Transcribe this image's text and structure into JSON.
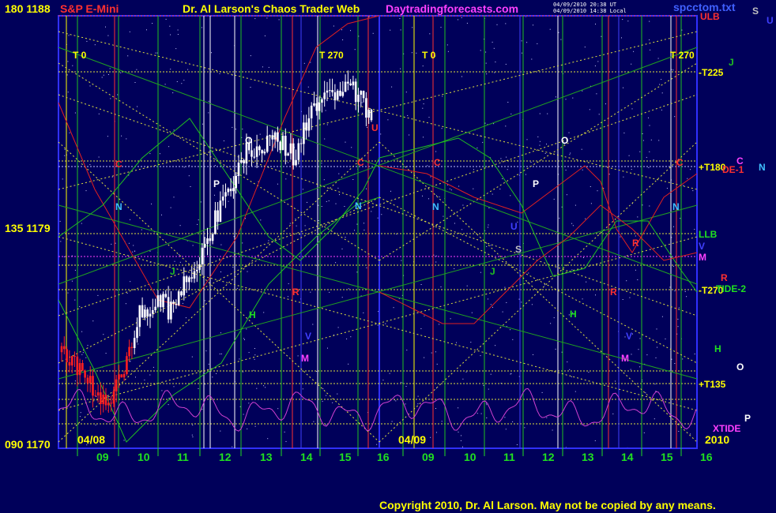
{
  "header": {
    "left_label": "180  1188",
    "symbol": "S&P E-Mini",
    "title": "Dr. Al Larson's Chaos Trader Web",
    "site": "Daytradingforecasts.com",
    "stamp1": "04/09/2010 20:38 UT",
    "stamp2": "04/09/2010 14:38 Local",
    "file": "spcctom.txt",
    "corner_s": "S",
    "corner_u": "U"
  },
  "left_labels": {
    "mid": "135  1179",
    "bottom": "090  1170"
  },
  "right_labels": [
    {
      "id": "ulb",
      "text": "ULB",
      "color": "#ff3030",
      "y": 20
    },
    {
      "id": "t225",
      "text": "-T225",
      "color": "#ffff00",
      "y": 91
    },
    {
      "id": "j",
      "text": "J",
      "color": "#20c020",
      "y": 78
    },
    {
      "id": "t180",
      "text": "+T180",
      "color": "#ffff00",
      "y": 211
    },
    {
      "id": "de1",
      "text": "DE-1",
      "color": "#ff3030",
      "y": 214
    },
    {
      "id": "c",
      "text": "C",
      "color": "#ff40ff",
      "y": 203
    },
    {
      "id": "n",
      "text": "N",
      "color": "#40c0ff",
      "y": 211
    },
    {
      "id": "llb",
      "text": "LLB",
      "color": "#20e020",
      "y": 296
    },
    {
      "id": "v",
      "text": "V",
      "color": "#4040ff",
      "y": 311
    },
    {
      "id": "m",
      "text": "M",
      "color": "#ff40ff",
      "y": 325
    },
    {
      "id": "r",
      "text": "R",
      "color": "#ff3030",
      "y": 351
    },
    {
      "id": "t270",
      "text": "-T270",
      "color": "#ffff00",
      "y": 367
    },
    {
      "id": "tide2",
      "text": "TIDE-2",
      "color": "#20e020",
      "y": 365
    },
    {
      "id": "h",
      "text": "H",
      "color": "#20e020",
      "y": 441
    },
    {
      "id": "o",
      "text": "O",
      "color": "#ffffff",
      "y": 464
    },
    {
      "id": "t135",
      "text": "+T135",
      "color": "#ffff00",
      "y": 486
    },
    {
      "id": "p",
      "text": "P",
      "color": "#ffffff",
      "y": 529
    },
    {
      "id": "xtide",
      "text": "XTIDE",
      "color": "#ff40ff",
      "y": 542
    }
  ],
  "x_axis": {
    "labels": [
      "09",
      "10",
      "11",
      "12",
      "13",
      "14",
      "15",
      "16",
      "09",
      "10",
      "11",
      "12",
      "13",
      "14",
      "15",
      "16"
    ],
    "date1": "04/08",
    "date2": "04/09",
    "year": "2010"
  },
  "markers": {
    "t0": "T  0",
    "t270": "T  270"
  },
  "point_labels": [
    {
      "t": "C",
      "c": "#ff3030"
    },
    {
      "t": "N",
      "c": "#40c0ff"
    },
    {
      "t": "P",
      "c": "#ffffff"
    },
    {
      "t": "O",
      "c": "#ffffff"
    },
    {
      "t": "J",
      "c": "#20c020"
    },
    {
      "t": "H",
      "c": "#20e020"
    },
    {
      "t": "R",
      "c": "#ff3030"
    },
    {
      "t": "V",
      "c": "#4040ff"
    },
    {
      "t": "M",
      "c": "#ff40ff"
    },
    {
      "t": "C",
      "c": "#ff3030"
    },
    {
      "t": "N",
      "c": "#40c0ff"
    },
    {
      "t": "U",
      "c": "#ff3030"
    },
    {
      "t": "C",
      "c": "#ff3030"
    },
    {
      "t": "N",
      "c": "#40c0ff"
    },
    {
      "t": "O",
      "c": "#ffffff"
    },
    {
      "t": "P",
      "c": "#ffffff"
    },
    {
      "t": "J",
      "c": "#20c020"
    },
    {
      "t": "H",
      "c": "#20e020"
    },
    {
      "t": "U",
      "c": "#4040ff"
    },
    {
      "t": "S",
      "c": "#c0c0c0"
    },
    {
      "t": "R",
      "c": "#ff3030"
    },
    {
      "t": "V",
      "c": "#4040ff"
    },
    {
      "t": "M",
      "c": "#ff40ff"
    },
    {
      "t": "C",
      "c": "#ff3030"
    },
    {
      "t": "N",
      "c": "#40c0ff"
    },
    {
      "t": "R",
      "c": "#ff3030"
    }
  ],
  "footer": {
    "copyright": "Copyright 2010, Dr. Al Larson. May not be copied by any means."
  },
  "chart_data": {
    "type": "line",
    "ylim": [
      1170,
      1188
    ],
    "price_series": [
      {
        "t": 0.0,
        "v": 1174.0
      },
      {
        "t": 0.25,
        "v": 1173.6
      },
      {
        "t": 0.5,
        "v": 1173.2
      },
      {
        "t": 0.75,
        "v": 1172.4
      },
      {
        "t": 1.0,
        "v": 1171.6
      },
      {
        "t": 1.25,
        "v": 1172.6
      },
      {
        "t": 1.5,
        "v": 1173.8
      },
      {
        "t": 1.75,
        "v": 1175.5
      },
      {
        "t": 2.0,
        "v": 1175.8
      },
      {
        "t": 2.25,
        "v": 1176.2
      },
      {
        "t": 2.5,
        "v": 1175.6
      },
      {
        "t": 2.75,
        "v": 1176.8
      },
      {
        "t": 3.0,
        "v": 1177.6
      },
      {
        "t": 3.25,
        "v": 1178.6
      },
      {
        "t": 3.5,
        "v": 1179.6
      },
      {
        "t": 3.75,
        "v": 1180.6
      },
      {
        "t": 4.0,
        "v": 1181.6
      },
      {
        "t": 4.25,
        "v": 1182.6
      },
      {
        "t": 4.5,
        "v": 1182.4
      },
      {
        "t": 4.75,
        "v": 1183.0
      },
      {
        "t": 5.0,
        "v": 1182.6
      },
      {
        "t": 5.25,
        "v": 1182.2
      },
      {
        "t": 5.5,
        "v": 1183.4
      },
      {
        "t": 5.75,
        "v": 1184.2
      },
      {
        "t": 6.0,
        "v": 1185.2
      },
      {
        "t": 6.25,
        "v": 1184.8
      },
      {
        "t": 6.5,
        "v": 1185.0
      },
      {
        "t": 6.75,
        "v": 1184.6
      },
      {
        "t": 7.0,
        "v": 1183.8
      }
    ],
    "grid": true
  },
  "colors": {
    "background": "#00005a",
    "grid_green": "#20c020",
    "grid_yellow_dotted": "#e0e040",
    "frame_blue": "#3030ff",
    "forecast_red": "#e02020",
    "forecast_green": "#20c020",
    "xtide_magenta": "#d040d0",
    "title_yellow": "#ffff00",
    "site_magenta": "#ff40ff"
  }
}
